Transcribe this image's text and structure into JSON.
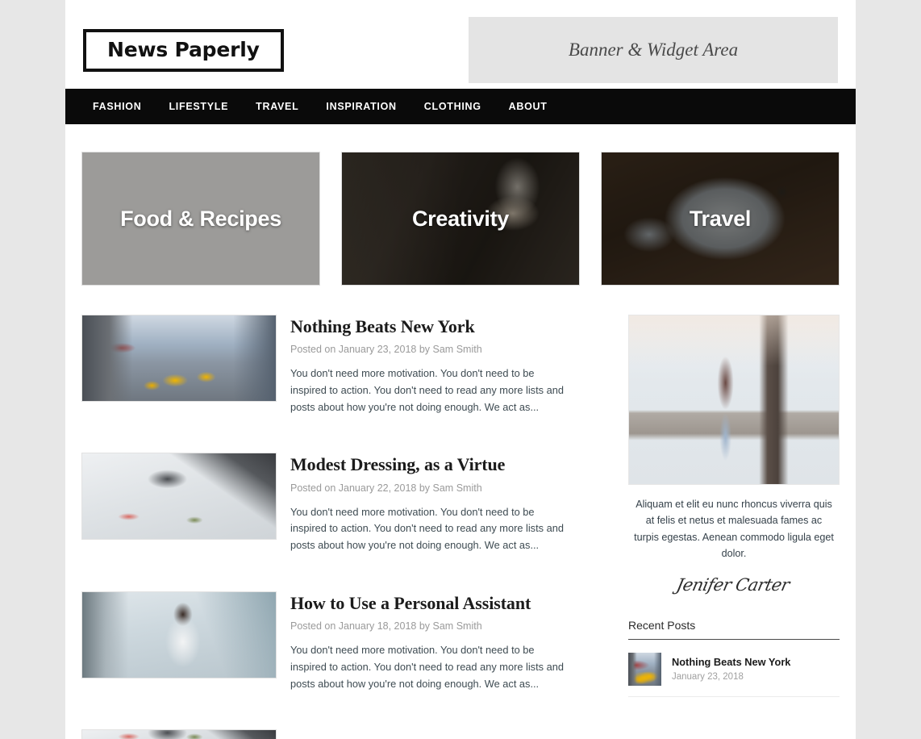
{
  "site": {
    "logo": "News Paperly",
    "banner_text": "Banner & Widget Area"
  },
  "nav": {
    "items": [
      {
        "label": "FASHION"
      },
      {
        "label": "LIFESTYLE"
      },
      {
        "label": "TRAVEL"
      },
      {
        "label": "INSPIRATION"
      },
      {
        "label": "CLOTHING"
      },
      {
        "label": "ABOUT"
      }
    ]
  },
  "tiles": [
    {
      "label": "Food & Recipes",
      "image": "food-table-photo"
    },
    {
      "label": "Creativity",
      "image": "laptop-desk-photo"
    },
    {
      "label": "Travel",
      "image": "map-laptop-photo"
    }
  ],
  "posts": [
    {
      "title": "Nothing Beats New York",
      "meta": "Posted on January 23, 2018 by Sam Smith",
      "excerpt": "You don't need more motivation. You don't need to be inspired to action. You don't need to read any more lists and posts about how you're not doing enough. We act as...",
      "image": "nyc-street-taxis-photo"
    },
    {
      "title": "Modest Dressing, as a Virtue",
      "meta": "Posted on January 22, 2018 by Sam Smith",
      "excerpt": "You don't need more motivation. You don't need to be inspired to action. You don't need to read any more lists and posts about how you're not doing enough. We act as...",
      "image": "design-desk-photo"
    },
    {
      "title": "How to Use a Personal Assistant",
      "meta": "Posted on January 18, 2018 by Sam Smith",
      "excerpt": "You don't need more motivation. You don't need to be inspired to action. You don't need to read any more lists and posts about how you're not doing enough. We act as...",
      "image": "woman-phone-desk-photo"
    }
  ],
  "sidebar": {
    "about": {
      "image": "winter-woman-stone-wall-photo",
      "text": "Aliquam et elit eu nunc rhoncus viverra quis at felis et netus et malesuada fames ac turpis egestas. Aenean commodo ligula eget dolor.",
      "signature": "Jenifer Carter"
    },
    "recent": {
      "title": "Recent Posts",
      "items": [
        {
          "title": "Nothing Beats New York",
          "date": "January 23, 2018",
          "image": "nyc-street-taxis-thumb"
        }
      ]
    }
  },
  "colors": {
    "page_bg": "#e7e7e7",
    "content_bg": "#ffffff",
    "nav_bg": "#0a0a0a",
    "banner_bg": "#e4e4e4",
    "meta_text": "#9a9a9a",
    "body_text": "#3e4b52"
  }
}
